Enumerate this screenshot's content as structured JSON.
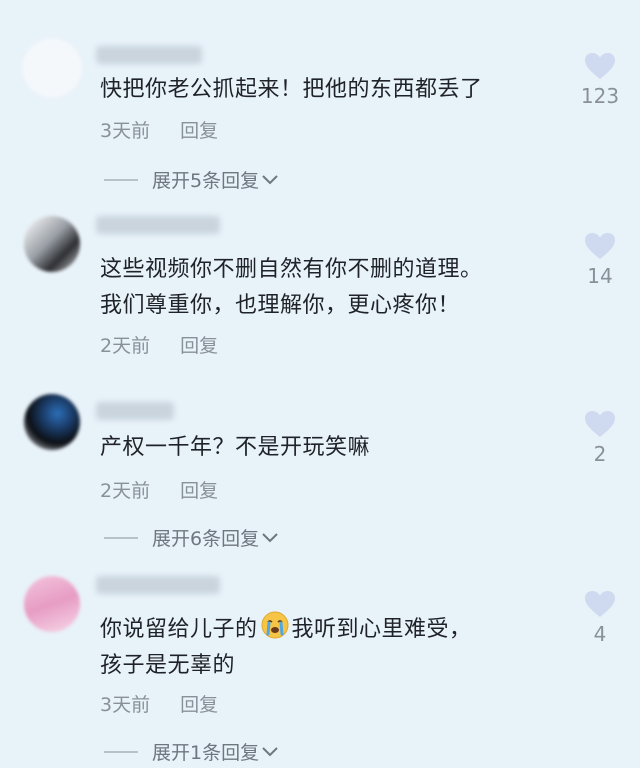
{
  "comments": [
    {
      "text": "快把你老公抓起来！把他的东西都丢了",
      "time": "3天前",
      "reply_label": "回复",
      "likes": "123",
      "expand_label": "展开5条回复"
    },
    {
      "text_line1": "这些视频你不删自然有你不删的道理。",
      "text_line2": "我们尊重你，也理解你，更心疼你！",
      "time": "2天前",
      "reply_label": "回复",
      "likes": "14"
    },
    {
      "text": "产权一千年？不是开玩笑嘛",
      "time": "2天前",
      "reply_label": "回复",
      "likes": "2",
      "expand_label": "展开6条回复"
    },
    {
      "text_part1": "你说留给儿子的",
      "text_part2": "我听到心里难受，",
      "text_line2": "孩子是无辜的",
      "time": "3天前",
      "reply_label": "回复",
      "likes": "4",
      "expand_label": "展开1条回复"
    }
  ],
  "colors": {
    "background": "#e8f2f9",
    "heart": "#cfdaf0",
    "meta_text": "#8a9099"
  }
}
